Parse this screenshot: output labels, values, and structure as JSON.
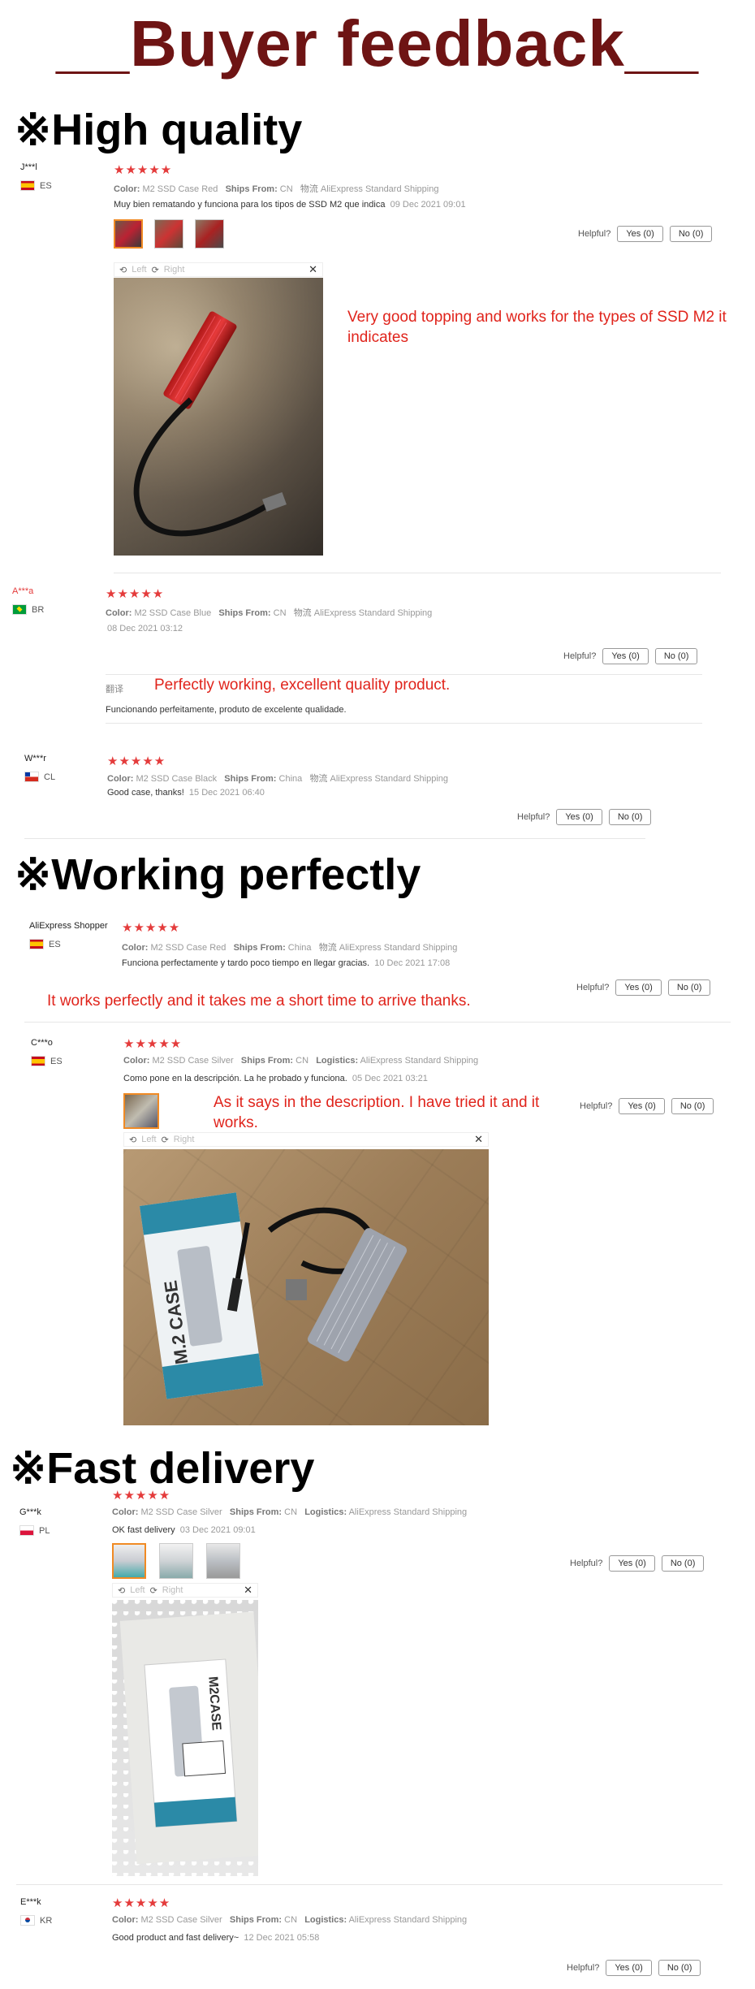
{
  "page_title": "__Buyer feedback__",
  "sections": {
    "s1": "※High quality",
    "s2": "※Working perfectly",
    "s3": "※Fast delivery"
  },
  "labels": {
    "color": "Color:",
    "ships_from": "Ships From:",
    "logistics_cn": "物流",
    "logistics": "Logistics:",
    "helpful": "Helpful?",
    "yes": "Yes (0)",
    "no": "No (0)",
    "left": "Left",
    "right": "Right",
    "translate": "翻译",
    "stars": "★★★★★"
  },
  "reviews": [
    {
      "user": "J***l",
      "country": "ES",
      "color": "M2 SSD Case Red",
      "ships": "CN",
      "logistics": "AliExpress Standard Shipping",
      "text": "Muy bien rematando y funciona para los tipos de SSD M2 que indica",
      "date": "09 Dec 2021 09:01",
      "annotation": "Very good topping and works for the types of SSD M2 it indicates"
    },
    {
      "user": "A***a",
      "country": "BR",
      "color": "M2 SSD Case Blue",
      "ships": "CN",
      "logistics": "AliExpress Standard Shipping",
      "date": "08 Dec 2021 03:12",
      "annotation": "Perfectly working, excellent quality product.",
      "text": "Funcionando perfeitamente, produto de excelente qualidade."
    },
    {
      "user": "W***r",
      "country": "CL",
      "color": "M2 SSD Case Black",
      "ships": "China",
      "logistics": "AliExpress Standard Shipping",
      "text": "Good case, thanks!",
      "date": "15 Dec 2021 06:40"
    },
    {
      "user": "AliExpress Shopper",
      "country": "ES",
      "color": "M2 SSD Case Red",
      "ships": "China",
      "logistics": "AliExpress Standard Shipping",
      "text": "Funciona perfectamente y tardo poco tiempo en llegar gracias.",
      "date": "10 Dec 2021 17:08",
      "annotation": "It works perfectly and it takes me a short time to arrive thanks."
    },
    {
      "user": "C***o",
      "country": "ES",
      "color": "M2 SSD Case Silver",
      "ships": "CN",
      "logistics": "AliExpress Standard Shipping",
      "text": "Como pone en la descripción. La he probado y funciona.",
      "date": "05 Dec 2021 03:21",
      "annotation": "As it says in the description. I have tried it and it works."
    },
    {
      "user": "G***k",
      "country": "PL",
      "color": "M2 SSD Case Silver",
      "ships": "CN",
      "logistics": "AliExpress Standard Shipping",
      "text": "OK fast delivery",
      "date": "03 Dec 2021 09:01"
    },
    {
      "user": "E***k",
      "country": "KR",
      "color": "M2 SSD Case Silver",
      "ships": "CN",
      "logistics": "AliExpress Standard Shipping",
      "text": "Good product and fast delivery~",
      "date": "12 Dec 2021 05:58"
    }
  ],
  "photo_text": {
    "box_label": "M.2 CASE",
    "box_label2": "M2CASE"
  }
}
